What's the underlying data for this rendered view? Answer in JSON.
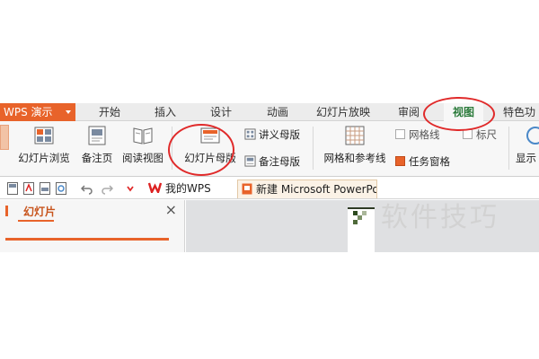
{
  "app_menu": "WPS 演示",
  "tabs": [
    "开始",
    "插入",
    "设计",
    "动画",
    "幻灯片放映",
    "审阅",
    "视图",
    "特色功"
  ],
  "active_tab": "视图",
  "ribbon": {
    "slide_browse": "幻灯片浏览",
    "notes_page": "备注页",
    "reading_view": "阅读视图",
    "slide_master": "幻灯片母版",
    "handout_master": "讲义母版",
    "notes_master": "备注母版",
    "grid_guides": "网格和参考线",
    "gridlines": "网格线",
    "ruler": "标尺",
    "task_pane": "任务窗格",
    "display_partial": "显示"
  },
  "toggles": {
    "gridlines": false,
    "ruler": false,
    "task_pane": true
  },
  "doc_tabs": {
    "my_wps": "我的WPS",
    "current": "新建 Microsoft PowerPo"
  },
  "pane": {
    "title": "幻灯片",
    "close": "×"
  },
  "watermark": "软件技巧",
  "colors": {
    "accent": "#e8632a",
    "annotation": "#e02a2a",
    "active_tab_text": "#2a7a3a"
  },
  "icons": [
    "slide-browse-icon",
    "notes-page-icon",
    "reading-view-icon",
    "slide-master-icon",
    "handout-master-icon",
    "notes-master-icon",
    "grid-guides-icon",
    "display-icon",
    "save-icon",
    "pdf-icon",
    "print-icon",
    "print-preview-icon",
    "undo-icon",
    "redo-icon",
    "wps-logo-icon",
    "presentation-icon"
  ]
}
